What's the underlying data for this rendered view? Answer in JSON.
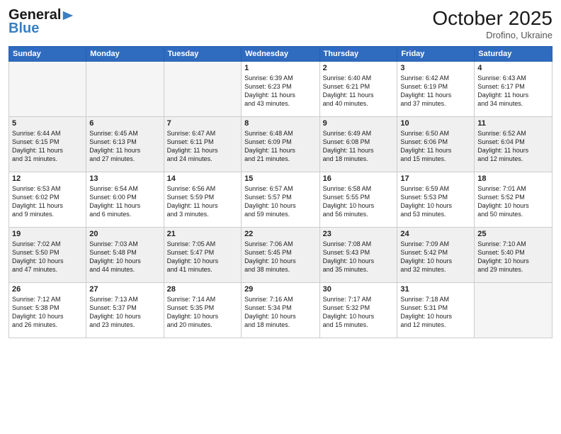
{
  "header": {
    "logo_line1": "General",
    "logo_line2": "Blue",
    "month": "October 2025",
    "location": "Drofino, Ukraine"
  },
  "days_of_week": [
    "Sunday",
    "Monday",
    "Tuesday",
    "Wednesday",
    "Thursday",
    "Friday",
    "Saturday"
  ],
  "weeks": [
    [
      {
        "day": "",
        "info": ""
      },
      {
        "day": "",
        "info": ""
      },
      {
        "day": "",
        "info": ""
      },
      {
        "day": "1",
        "info": "Sunrise: 6:39 AM\nSunset: 6:23 PM\nDaylight: 11 hours\nand 43 minutes."
      },
      {
        "day": "2",
        "info": "Sunrise: 6:40 AM\nSunset: 6:21 PM\nDaylight: 11 hours\nand 40 minutes."
      },
      {
        "day": "3",
        "info": "Sunrise: 6:42 AM\nSunset: 6:19 PM\nDaylight: 11 hours\nand 37 minutes."
      },
      {
        "day": "4",
        "info": "Sunrise: 6:43 AM\nSunset: 6:17 PM\nDaylight: 11 hours\nand 34 minutes."
      }
    ],
    [
      {
        "day": "5",
        "info": "Sunrise: 6:44 AM\nSunset: 6:15 PM\nDaylight: 11 hours\nand 31 minutes."
      },
      {
        "day": "6",
        "info": "Sunrise: 6:45 AM\nSunset: 6:13 PM\nDaylight: 11 hours\nand 27 minutes."
      },
      {
        "day": "7",
        "info": "Sunrise: 6:47 AM\nSunset: 6:11 PM\nDaylight: 11 hours\nand 24 minutes."
      },
      {
        "day": "8",
        "info": "Sunrise: 6:48 AM\nSunset: 6:09 PM\nDaylight: 11 hours\nand 21 minutes."
      },
      {
        "day": "9",
        "info": "Sunrise: 6:49 AM\nSunset: 6:08 PM\nDaylight: 11 hours\nand 18 minutes."
      },
      {
        "day": "10",
        "info": "Sunrise: 6:50 AM\nSunset: 6:06 PM\nDaylight: 11 hours\nand 15 minutes."
      },
      {
        "day": "11",
        "info": "Sunrise: 6:52 AM\nSunset: 6:04 PM\nDaylight: 11 hours\nand 12 minutes."
      }
    ],
    [
      {
        "day": "12",
        "info": "Sunrise: 6:53 AM\nSunset: 6:02 PM\nDaylight: 11 hours\nand 9 minutes."
      },
      {
        "day": "13",
        "info": "Sunrise: 6:54 AM\nSunset: 6:00 PM\nDaylight: 11 hours\nand 6 minutes."
      },
      {
        "day": "14",
        "info": "Sunrise: 6:56 AM\nSunset: 5:59 PM\nDaylight: 11 hours\nand 3 minutes."
      },
      {
        "day": "15",
        "info": "Sunrise: 6:57 AM\nSunset: 5:57 PM\nDaylight: 10 hours\nand 59 minutes."
      },
      {
        "day": "16",
        "info": "Sunrise: 6:58 AM\nSunset: 5:55 PM\nDaylight: 10 hours\nand 56 minutes."
      },
      {
        "day": "17",
        "info": "Sunrise: 6:59 AM\nSunset: 5:53 PM\nDaylight: 10 hours\nand 53 minutes."
      },
      {
        "day": "18",
        "info": "Sunrise: 7:01 AM\nSunset: 5:52 PM\nDaylight: 10 hours\nand 50 minutes."
      }
    ],
    [
      {
        "day": "19",
        "info": "Sunrise: 7:02 AM\nSunset: 5:50 PM\nDaylight: 10 hours\nand 47 minutes."
      },
      {
        "day": "20",
        "info": "Sunrise: 7:03 AM\nSunset: 5:48 PM\nDaylight: 10 hours\nand 44 minutes."
      },
      {
        "day": "21",
        "info": "Sunrise: 7:05 AM\nSunset: 5:47 PM\nDaylight: 10 hours\nand 41 minutes."
      },
      {
        "day": "22",
        "info": "Sunrise: 7:06 AM\nSunset: 5:45 PM\nDaylight: 10 hours\nand 38 minutes."
      },
      {
        "day": "23",
        "info": "Sunrise: 7:08 AM\nSunset: 5:43 PM\nDaylight: 10 hours\nand 35 minutes."
      },
      {
        "day": "24",
        "info": "Sunrise: 7:09 AM\nSunset: 5:42 PM\nDaylight: 10 hours\nand 32 minutes."
      },
      {
        "day": "25",
        "info": "Sunrise: 7:10 AM\nSunset: 5:40 PM\nDaylight: 10 hours\nand 29 minutes."
      }
    ],
    [
      {
        "day": "26",
        "info": "Sunrise: 7:12 AM\nSunset: 5:38 PM\nDaylight: 10 hours\nand 26 minutes."
      },
      {
        "day": "27",
        "info": "Sunrise: 7:13 AM\nSunset: 5:37 PM\nDaylight: 10 hours\nand 23 minutes."
      },
      {
        "day": "28",
        "info": "Sunrise: 7:14 AM\nSunset: 5:35 PM\nDaylight: 10 hours\nand 20 minutes."
      },
      {
        "day": "29",
        "info": "Sunrise: 7:16 AM\nSunset: 5:34 PM\nDaylight: 10 hours\nand 18 minutes."
      },
      {
        "day": "30",
        "info": "Sunrise: 7:17 AM\nSunset: 5:32 PM\nDaylight: 10 hours\nand 15 minutes."
      },
      {
        "day": "31",
        "info": "Sunrise: 7:18 AM\nSunset: 5:31 PM\nDaylight: 10 hours\nand 12 minutes."
      },
      {
        "day": "",
        "info": ""
      }
    ]
  ]
}
